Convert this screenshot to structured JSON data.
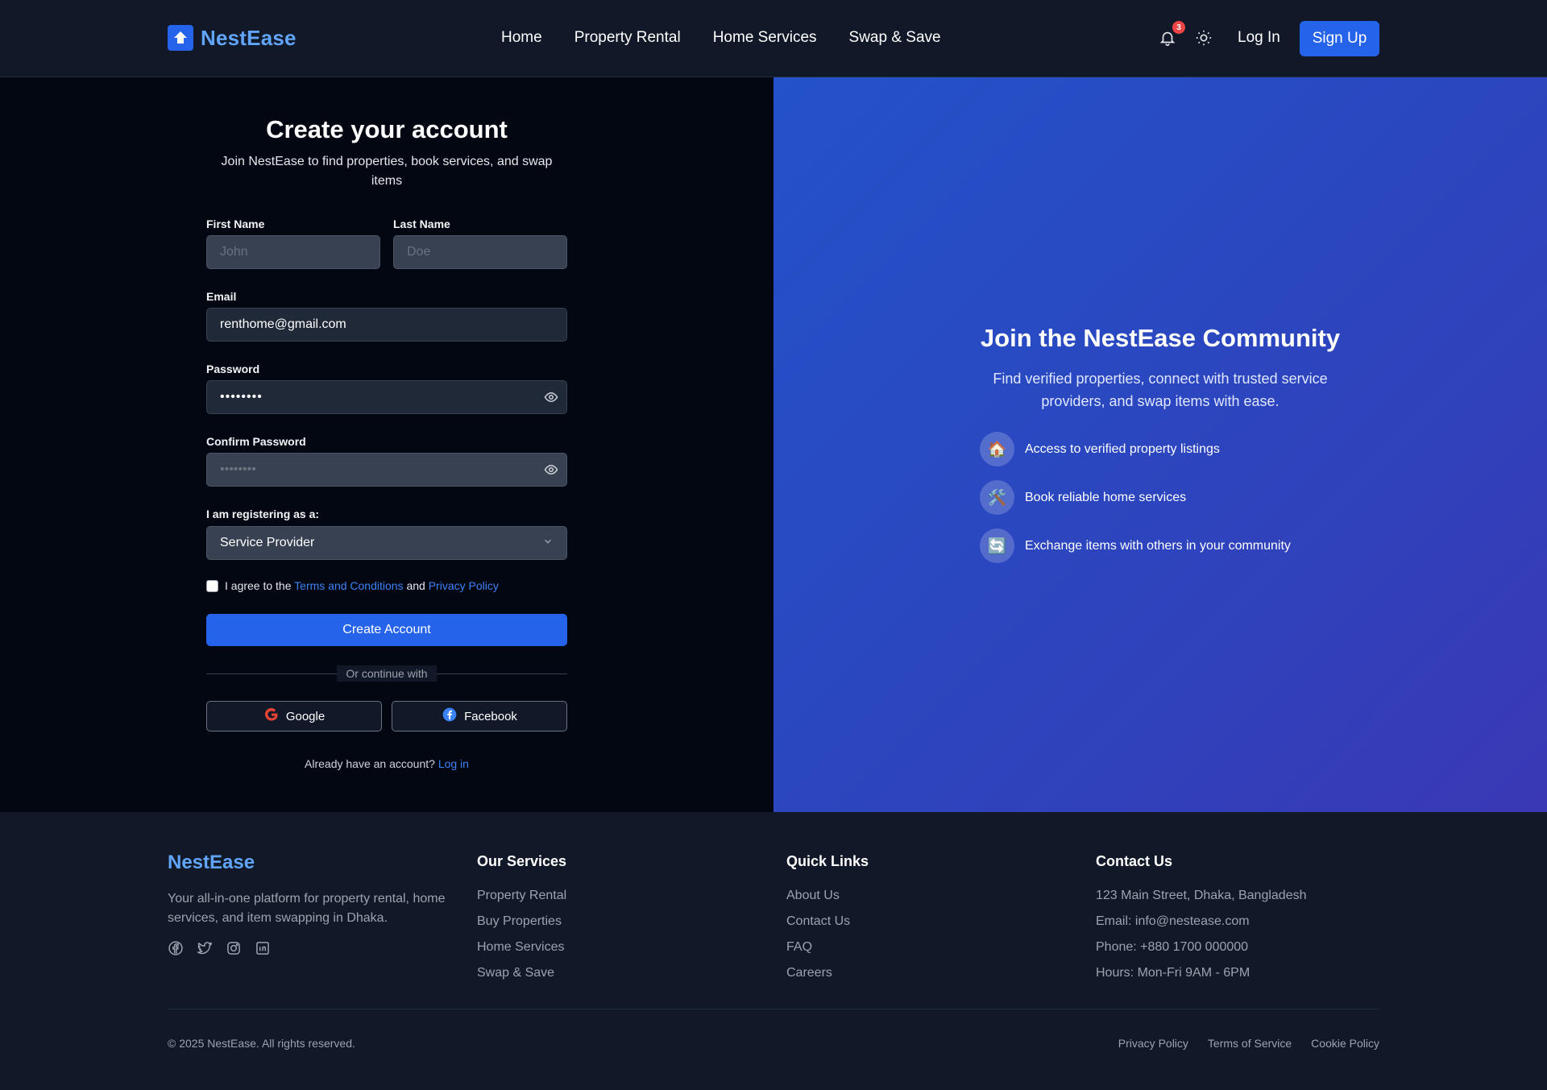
{
  "brand": {
    "name": "NestEase"
  },
  "nav": {
    "links": [
      "Home",
      "Property Rental",
      "Home Services",
      "Swap & Save"
    ],
    "notification_count": "3",
    "login_label": "Log In",
    "signup_label": "Sign Up"
  },
  "form": {
    "title": "Create your account",
    "subtitle": "Join NestEase to find properties, book services, and swap items",
    "first_name": {
      "label": "First Name",
      "placeholder": "John",
      "value": ""
    },
    "last_name": {
      "label": "Last Name",
      "placeholder": "Doe",
      "value": ""
    },
    "email": {
      "label": "Email",
      "value": "renthome@gmail.com"
    },
    "password": {
      "label": "Password",
      "value": "••••••••"
    },
    "confirm_password": {
      "label": "Confirm Password",
      "placeholder": "••••••••"
    },
    "role": {
      "label": "I am registering as a:",
      "value": "Service Provider"
    },
    "agree": {
      "prefix": "I agree to the",
      "terms": "Terms and Conditions",
      "and": "and",
      "privacy": "Privacy Policy"
    },
    "submit_label": "Create Account",
    "divider": "Or continue with",
    "google_label": "Google",
    "facebook_label": "Facebook",
    "already_text": "Already have an account?",
    "login_link": "Log in"
  },
  "promo": {
    "title": "Join the NestEase Community",
    "subtitle": "Find verified properties, connect with trusted service providers, and swap items with ease.",
    "features": [
      {
        "icon": "house-emoji-icon",
        "glyph": "🏠",
        "text": "Access to verified property listings"
      },
      {
        "icon": "tools-emoji-icon",
        "glyph": "🛠️",
        "text": "Book reliable home services"
      },
      {
        "icon": "exchange-emoji-icon",
        "glyph": "🔄",
        "text": "Exchange items with others in your community"
      }
    ]
  },
  "footer": {
    "brand": "NestEase",
    "description": "Your all-in-one platform for property rental, home services, and item swapping in Dhaka.",
    "services": {
      "title": "Our Services",
      "items": [
        "Property Rental",
        "Buy Properties",
        "Home Services",
        "Swap & Save"
      ]
    },
    "quick_links": {
      "title": "Quick Links",
      "items": [
        "About Us",
        "Contact Us",
        "FAQ",
        "Careers"
      ]
    },
    "contact": {
      "title": "Contact Us",
      "items": [
        "123 Main Street, Dhaka, Bangladesh",
        "Email: info@nestease.com",
        "Phone: +880 1700 000000",
        "Hours: Mon-Fri 9AM - 6PM"
      ]
    },
    "copyright": "© 2025 NestEase. All rights reserved.",
    "legal": [
      "Privacy Policy",
      "Terms of Service",
      "Cookie Policy"
    ]
  },
  "colors": {
    "accent": "#2563eb",
    "brand_text": "#60a5fa",
    "link": "#3b82f6",
    "badge": "#ef4444"
  }
}
